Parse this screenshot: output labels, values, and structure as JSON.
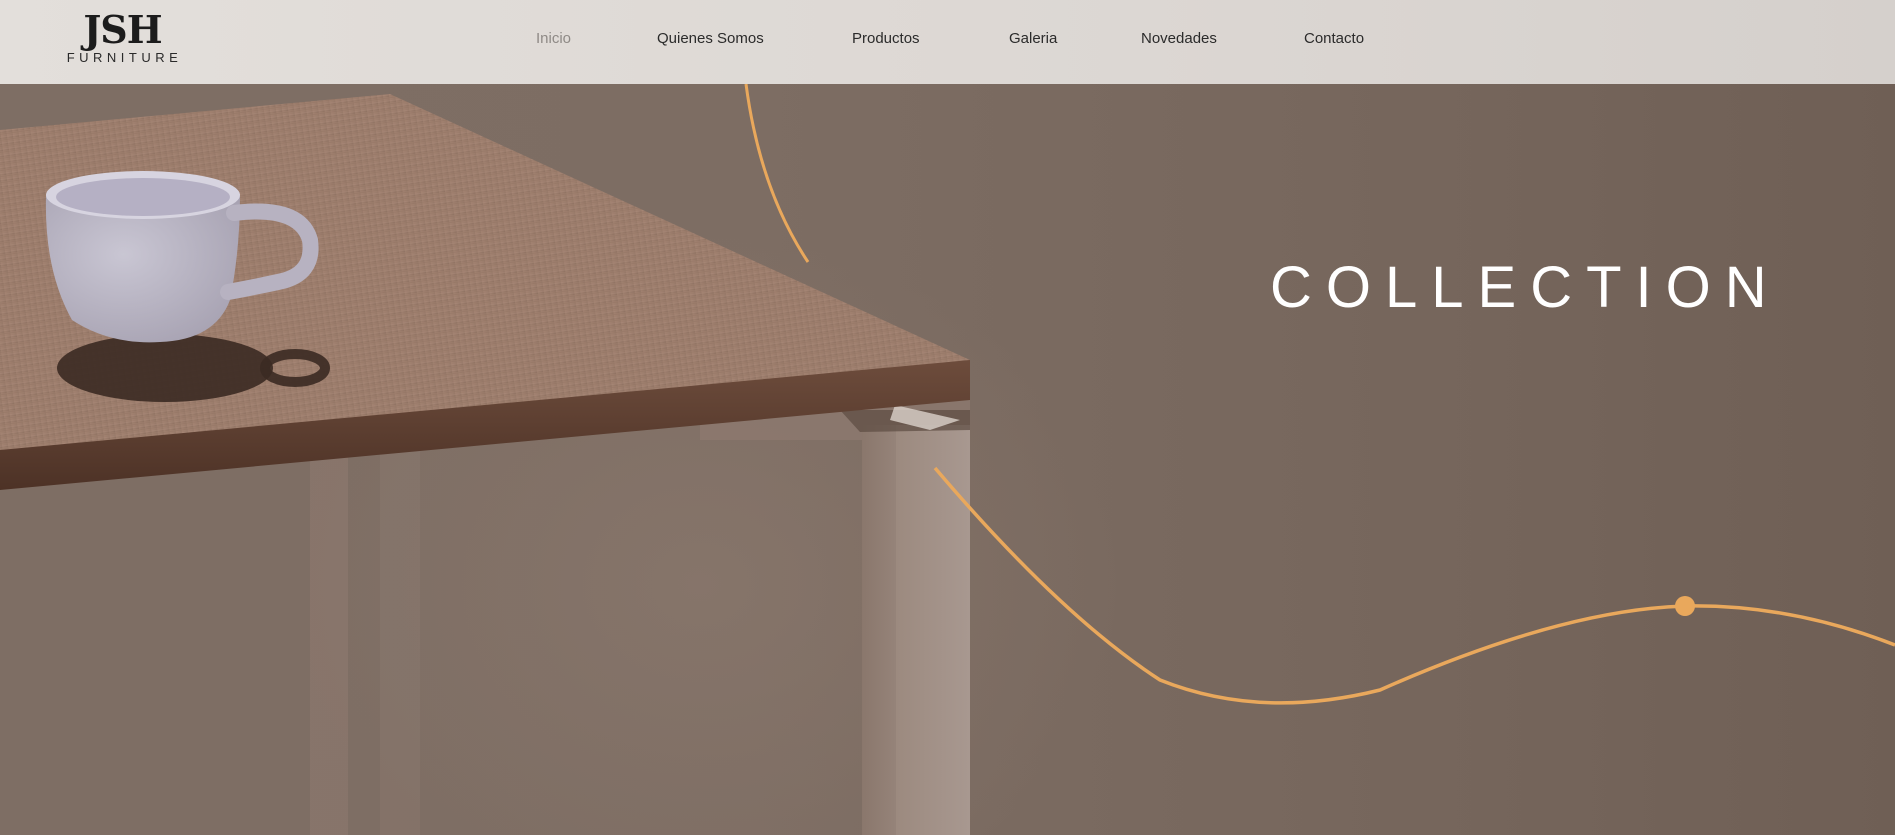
{
  "logo": {
    "name": "JSH",
    "tagline": "FURNITURE"
  },
  "nav": {
    "items": [
      {
        "label": "Inicio",
        "active": true
      },
      {
        "label": "Quienes Somos",
        "active": false
      },
      {
        "label": "Productos",
        "active": false
      },
      {
        "label": "Galeria",
        "active": false
      },
      {
        "label": "Novedades",
        "active": false
      },
      {
        "label": "Contacto",
        "active": false
      }
    ]
  },
  "hero": {
    "title": "COLLECTION"
  },
  "colors": {
    "accent": "#e9a85c",
    "header_bg": "#dfdad6",
    "hero_bg": "#7a6a60",
    "text_dark": "#2b2b2b",
    "nav_active": "#8f8a86"
  }
}
